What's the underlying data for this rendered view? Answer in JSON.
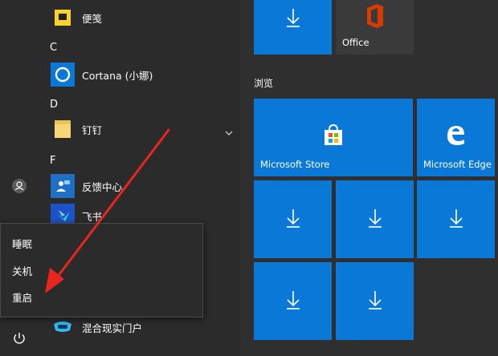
{
  "applist": {
    "items": [
      {
        "label": "便笺"
      },
      {
        "letter": "C"
      },
      {
        "label": "Cortana (小娜)"
      },
      {
        "letter": "D"
      },
      {
        "label": "钉钉"
      },
      {
        "letter": "F"
      },
      {
        "label": "反馈中心"
      },
      {
        "label": "飞书"
      },
      {
        "label": "混合现实门户"
      }
    ]
  },
  "tiles": {
    "office_label": "Office",
    "group_label": "浏览",
    "store_label": "Microsoft Store",
    "edge_label": "Microsoft Edge"
  },
  "power_menu": {
    "sleep": "睡眠",
    "shutdown": "关机",
    "restart": "重启"
  },
  "colors": {
    "tile_blue": "#0a78d7",
    "annotation_red": "#e8261f",
    "background": "#2b2b2b"
  }
}
